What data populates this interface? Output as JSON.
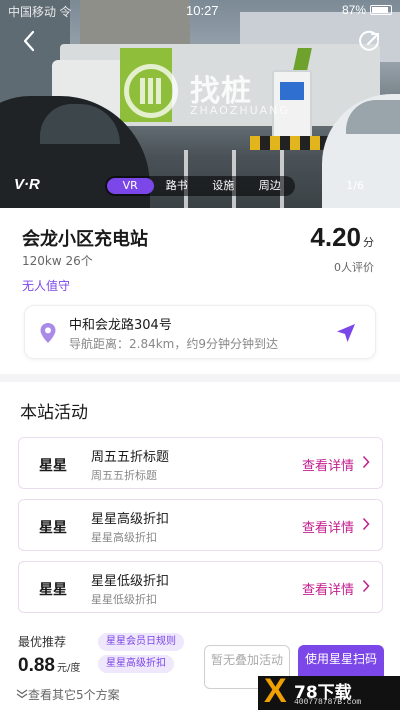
{
  "status_bar": {
    "left": "中国移动 令",
    "time": "10:27",
    "battery": "87%"
  },
  "hero": {
    "watermark_title": "找桩",
    "watermark_sub": "ZHAOZHUANG",
    "vr_logo": "V·R",
    "tabs": [
      {
        "label": "VR",
        "active": true
      },
      {
        "label": "路书",
        "active": false
      },
      {
        "label": "设施",
        "active": false
      },
      {
        "label": "周边",
        "active": false
      }
    ],
    "counter": "1/6"
  },
  "station": {
    "name": "会龙小区充电站",
    "power": "120kw 26个",
    "tag": "无人值守",
    "score": "4.20",
    "score_unit": "分",
    "reviews": "0人评价",
    "address": "中和会龙路304号",
    "distance": "导航距离：2.84km，约9分钟分钟到达"
  },
  "activities": {
    "title": "本站活动",
    "items": [
      {
        "name": "星星",
        "title": "周五五折标题",
        "subtitle": "周五五折标题",
        "link": "查看详情"
      },
      {
        "name": "星星",
        "title": "星星高级折扣",
        "subtitle": "星星高级折扣",
        "link": "查看详情"
      },
      {
        "name": "星星",
        "title": "星星低级折扣",
        "subtitle": "星星低级折扣",
        "link": "查看详情"
      }
    ]
  },
  "bottom": {
    "rec_label": "最优推荐",
    "price": "0.88",
    "price_unit": "元/度",
    "pills": [
      "星星会员日规则",
      "星星高级折扣"
    ],
    "more": "查看其它5个方案",
    "btn_gray": "暂无叠加活动",
    "btn_purple": "使用星星扫码"
  },
  "watermark_site": {
    "title": "78下载",
    "url": "400778787B.com"
  },
  "colors": {
    "accent": "#7b47e8",
    "link": "#c21f8e"
  }
}
